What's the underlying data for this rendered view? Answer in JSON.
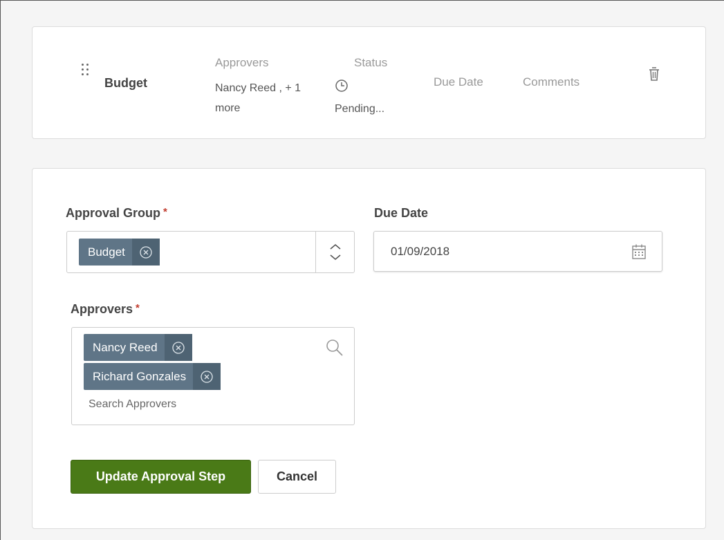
{
  "summary": {
    "step_name": "Budget",
    "approvers_label": "Approvers",
    "approvers_value": "Nancy Reed , + 1 more",
    "status_label": "Status",
    "status_value": "Pending...",
    "due_date_label": "Due Date",
    "comments_label": "Comments",
    "icons": [
      "drag-handle-icon",
      "clock-icon",
      "trash-icon"
    ]
  },
  "form": {
    "approval_group_label": "Approval Group",
    "approval_group_tags": [
      "Budget"
    ],
    "due_date_label": "Due Date",
    "due_date_value": "01/09/2018",
    "approvers_label": "Approvers",
    "approvers_tags": [
      "Nancy Reed",
      "Richard Gonzales"
    ],
    "search_placeholder": "Search Approvers",
    "required_mark": "*",
    "icons": [
      "remove-tag-icon",
      "select-stepper-icon",
      "calendar-icon",
      "search-icon"
    ]
  },
  "actions": {
    "update_label": "Update Approval Step",
    "cancel_label": "Cancel"
  },
  "colors": {
    "tag_bg": "#5f7587",
    "primary_button": "#4a7a17",
    "required": "#c0392b"
  }
}
